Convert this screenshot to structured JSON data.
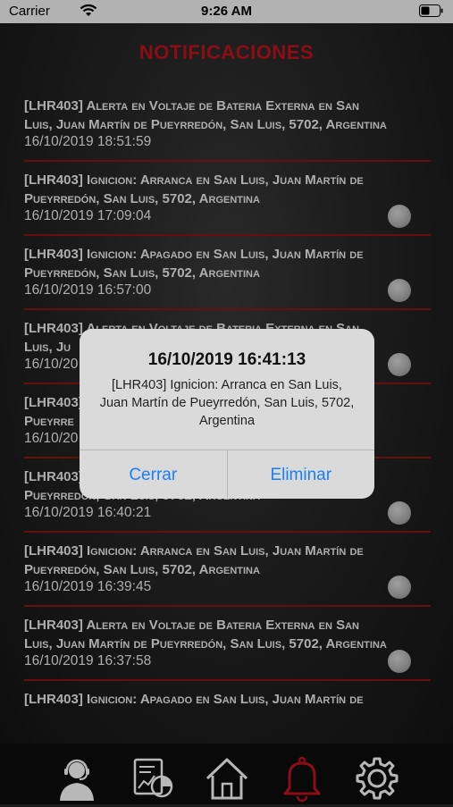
{
  "status_bar": {
    "carrier": "Carrier",
    "time": "9:26 AM"
  },
  "header": {
    "title": "NOTIFICACIONES",
    "title_color": "#c1121f"
  },
  "notifications": [
    {
      "line1": "[LHR403] Alerta en Voltaje de Bateria Externa en San",
      "line2": "Luis, Juan Martín de Pueyrredón, San Luis, 5702, Argentina",
      "date": "16/10/2019 18:51:59",
      "dot": false
    },
    {
      "line1": "[LHR403] Ignicion: Arranca en San Luis, Juan Martín de",
      "line2": "Pueyrredón, San Luis, 5702, Argentina",
      "date": "16/10/2019 17:09:04",
      "dot": true
    },
    {
      "line1": "[LHR403] Ignicion: Apagado en San Luis, Juan Martín de",
      "line2": "Pueyrredón, San Luis, 5702, Argentina",
      "date": "16/10/2019 16:57:00",
      "dot": true
    },
    {
      "line1": "[LHR403] Alerta en Voltaje de Bateria Externa en San",
      "line2": "Luis, Ju",
      "date": "16/10/20",
      "dot": true
    },
    {
      "line1": "[LHR403]",
      "line2": "Pueyrre",
      "date": "16/10/20",
      "dot": false
    },
    {
      "line1": "[LHR403]",
      "line2": "Pueyrredón, San Luis, 5702, Argentina",
      "date": "16/10/2019 16:40:21",
      "dot": true
    },
    {
      "line1": "[LHR403] Ignicion: Arranca en San Luis, Juan Martín de",
      "line2": "Pueyrredón, San Luis, 5702, Argentina",
      "date": "16/10/2019 16:39:45",
      "dot": true
    },
    {
      "line1": "[LHR403] Alerta en Voltaje de Bateria Externa en San",
      "line2": "Luis, Juan Martín de Pueyrredón, San Luis, 5702, Argentina",
      "date": "16/10/2019 16:37:58",
      "dot": true
    },
    {
      "line1": "[LHR403] Ignicion: Apagado en San Luis, Juan Martín de",
      "line2": "",
      "date": "",
      "dot": false
    }
  ],
  "alert": {
    "title": "16/10/2019 16:41:13",
    "message": "[LHR403] Ignicion: Arranca en San Luis, Juan Martín de Pueyrredón, San Luis, 5702, Argentina",
    "cancel_label": "Cerrar",
    "delete_label": "Eliminar",
    "button_color": "#1a7ff6"
  },
  "tab_bar": {
    "tabs": [
      {
        "icon": "support-agent-icon",
        "active": false
      },
      {
        "icon": "report-chart-icon",
        "active": false
      },
      {
        "icon": "home-icon",
        "active": false
      },
      {
        "icon": "bell-icon",
        "active": true
      },
      {
        "icon": "gear-icon",
        "active": false
      }
    ],
    "active_color": "#c1121f",
    "inactive_color": "#ffffff"
  }
}
